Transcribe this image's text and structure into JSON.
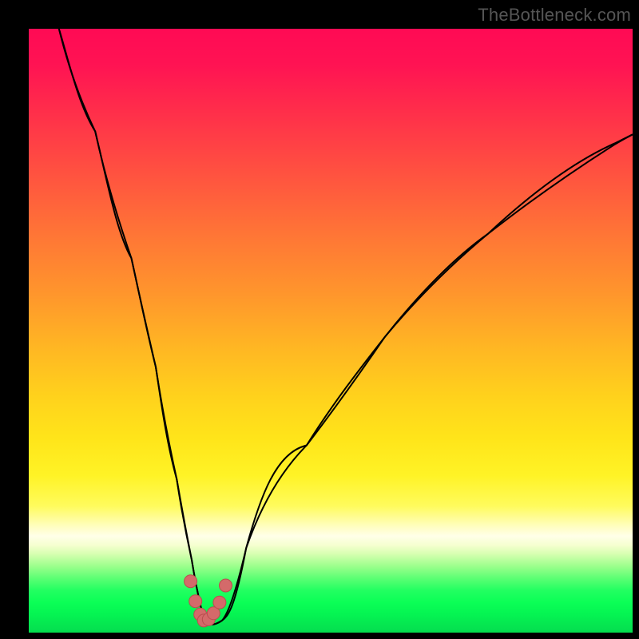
{
  "watermark": "TheBottleneck.com",
  "chart_data": {
    "type": "line",
    "title": "",
    "xlabel": "",
    "ylabel": "",
    "xlim": [
      0,
      100
    ],
    "ylim": [
      0,
      100
    ],
    "background_metric_range": {
      "top_color": "#ff0a54",
      "bottom_color": "#05e450"
    },
    "series": [
      {
        "name": "bottleneck-curve",
        "x": [
          5,
          8,
          11,
          14,
          17,
          19,
          21,
          23,
          24.5,
          26,
          27,
          28,
          28.8,
          29.5,
          30.5,
          32,
          34,
          37,
          41,
          46,
          52,
          59,
          67,
          76,
          86,
          97,
          100
        ],
        "y": [
          100,
          92,
          83,
          73,
          62,
          53,
          44,
          34,
          25,
          17,
          11,
          6,
          3,
          1.5,
          2,
          4,
          8,
          14,
          22,
          31,
          40,
          49,
          58,
          66,
          74,
          81,
          82.5
        ]
      }
    ],
    "markers": {
      "name": "highlight-points",
      "x": [
        26.8,
        27.6,
        28.4,
        29.0,
        29.8,
        30.6,
        31.6,
        32.6
      ],
      "y": [
        8.5,
        5.2,
        3.0,
        2.0,
        2.2,
        3.2,
        5.0,
        7.8
      ]
    }
  }
}
